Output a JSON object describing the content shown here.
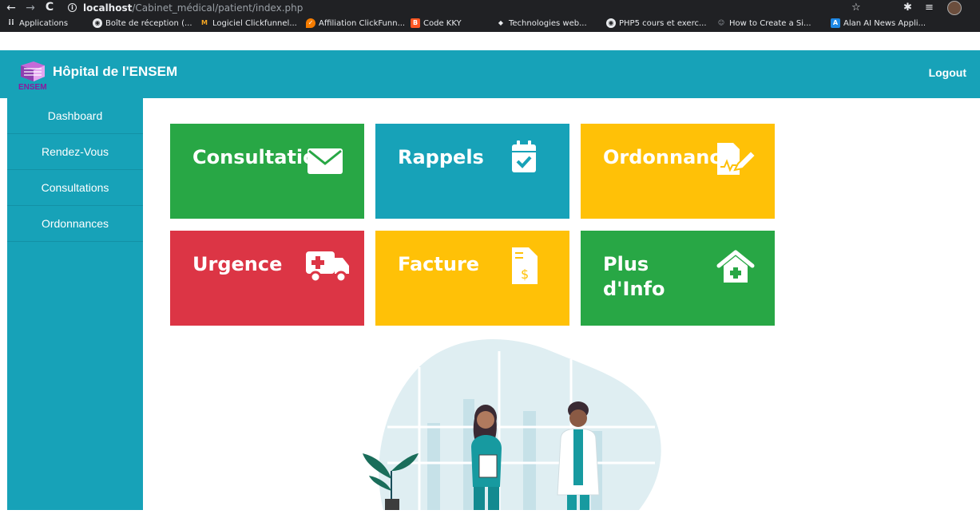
{
  "browser": {
    "url_host": "localhost",
    "url_path": "/Cabinet_médical/patient/index.php",
    "bookmarks": [
      {
        "label": "Applications",
        "icon": "apps-grid-icon",
        "color": "#e8eaed"
      },
      {
        "label": "Boîte de réception (...",
        "icon": "chrome-icon",
        "color": "#e8eaed"
      },
      {
        "label": "Logiciel Clickfunnel...",
        "icon": "clickfunnels-icon",
        "color": "#f5a623"
      },
      {
        "label": "Affiliation ClickFunn...",
        "icon": "shield-icon",
        "color": "#f57c00"
      },
      {
        "label": "Code KKY",
        "icon": "blogger-icon",
        "color": "#ff5722"
      },
      {
        "label": "Technologies web...",
        "icon": "diamond-icon",
        "color": "#e8eaed"
      },
      {
        "label": "PHP5 cours et exerc...",
        "icon": "chrome-icon",
        "color": "#e8eaed"
      },
      {
        "label": "How to Create a Si...",
        "icon": "person-icon",
        "color": "#9aa0a6"
      },
      {
        "label": "Alan AI News Appli...",
        "icon": "alan-icon",
        "color": "#1e88e5"
      }
    ]
  },
  "navbar": {
    "logo_text": "ENSEM",
    "brand": "Hôpital de l'ENSEM",
    "logout": "Logout"
  },
  "sidebar": {
    "items": [
      {
        "label": "Dashboard"
      },
      {
        "label": "Rendez-Vous"
      },
      {
        "label": "Consultations"
      },
      {
        "label": "Ordonnances"
      }
    ]
  },
  "tiles": [
    {
      "label": "Consultation",
      "icon": "envelope-icon",
      "color": "#28a745"
    },
    {
      "label": "Rappels",
      "icon": "calendar-check-icon",
      "color": "#17a2b8"
    },
    {
      "label": "Ordonnance",
      "icon": "prescription-edit-icon",
      "color": "#ffc107"
    },
    {
      "label": "Urgence",
      "icon": "ambulance-icon",
      "color": "#dc3545"
    },
    {
      "label": "Facture",
      "icon": "invoice-dollar-icon",
      "color": "#ffc107"
    },
    {
      "label": "Plus d'Info",
      "icon": "clinic-house-icon",
      "color": "#28a745"
    }
  ]
}
